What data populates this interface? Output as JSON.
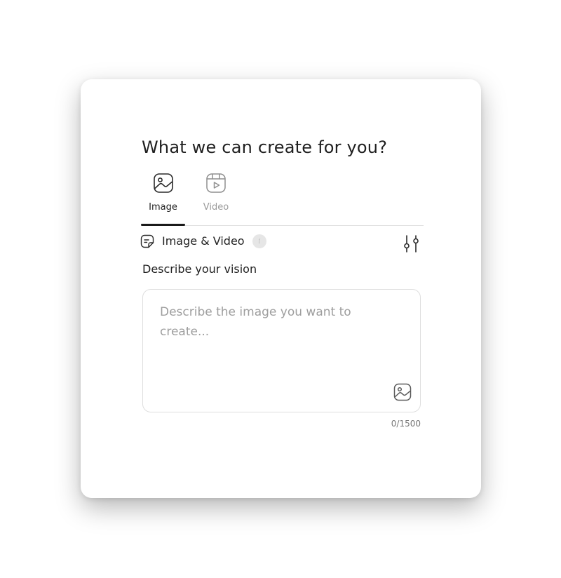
{
  "header": {
    "title": "What we can create for you?"
  },
  "tabs": [
    {
      "label": "Image",
      "icon": "image-icon",
      "active": true
    },
    {
      "label": "Video",
      "icon": "video-icon",
      "active": false
    }
  ],
  "mode": {
    "icon": "document-icon",
    "label": "Image & Video",
    "info_icon": "info-icon"
  },
  "settings": {
    "icon": "sliders-icon"
  },
  "prompt": {
    "label": "Describe your vision",
    "value": "",
    "placeholder": "Describe the image you want to create...",
    "attach_icon": "image-icon"
  },
  "counter": {
    "text": "0/1500",
    "current": 0,
    "max": 1500
  },
  "colors": {
    "text_primary": "#222222",
    "text_muted": "#9a9a9a",
    "tab_active_underline": "#1a1a1a",
    "border": "#dedede",
    "background": "#ffffff"
  }
}
